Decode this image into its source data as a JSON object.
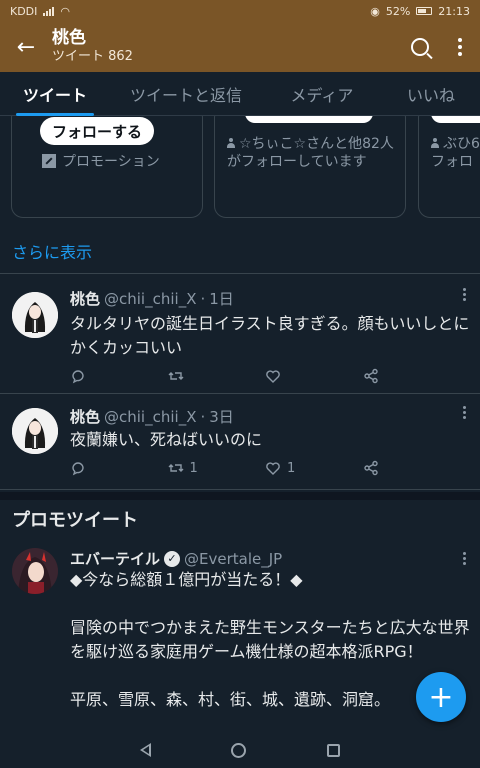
{
  "status_bar": {
    "carrier": "KDDI",
    "battery": "52%",
    "time": "21:13"
  },
  "app_bar": {
    "title": "桃色",
    "subtitle": "ツイート 862"
  },
  "tabs": [
    {
      "label": "ツイート",
      "active": true
    },
    {
      "label": "ツイートと返信",
      "active": false
    },
    {
      "label": "メディア",
      "active": false
    },
    {
      "label": "いいね",
      "active": false
    }
  ],
  "suggestion_cards": [
    {
      "follow_label": "フォローする",
      "promo_label": "プロモーション"
    },
    {
      "followers_text": "☆ちぃこ☆さんと他82人がフォローしています"
    },
    {
      "followers_text": "ぶひ6 フォロ"
    }
  ],
  "show_more_label": "さらに表示",
  "tweets": [
    {
      "name": "桃色",
      "handle": "@chii_chii_X",
      "time": "1日",
      "text": "タルタリヤの誕生日イラスト良すぎる。顔もいいしとにかくカッコいい",
      "retweets": "",
      "likes": ""
    },
    {
      "name": "桃色",
      "handle": "@chii_chii_X",
      "time": "3日",
      "text": "夜蘭嫌い、死ねばいいのに",
      "retweets": "1",
      "likes": "1"
    }
  ],
  "promoted_header": "プロモツイート",
  "promoted_tweet": {
    "name": "エバーテイル",
    "handle": "@Evertale_JP",
    "line1": "◆今なら総額１億円が当たる！◆",
    "line2": "冒険の中でつかまえた野生モンスターたちと広大な世界を駆け巡る家庭用ゲーム機仕様の超本格派RPG！",
    "line3": "平原、雪原、森、村、街、城、遺跡、洞窟。"
  },
  "colors": {
    "app_bar": "#7a5527",
    "background": "#15202b",
    "accent": "#1d9bf0"
  }
}
